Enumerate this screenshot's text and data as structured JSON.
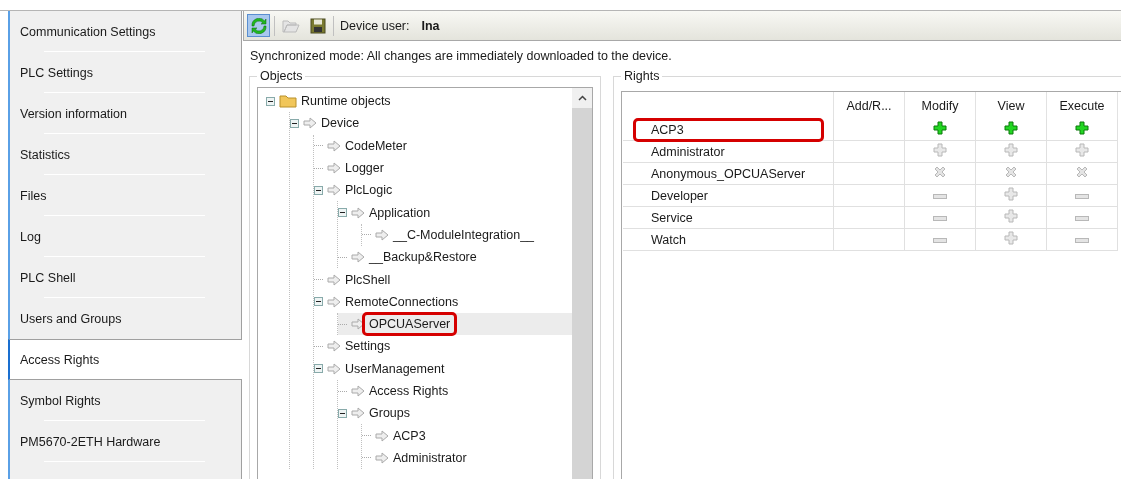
{
  "sidebar": {
    "items": [
      {
        "label": "Communication Settings",
        "selected": false
      },
      {
        "label": "PLC Settings",
        "selected": false
      },
      {
        "label": "Version information",
        "selected": false
      },
      {
        "label": "Statistics",
        "selected": false
      },
      {
        "label": "Files",
        "selected": false
      },
      {
        "label": "Log",
        "selected": false
      },
      {
        "label": "PLC Shell",
        "selected": false
      },
      {
        "label": "Users and Groups",
        "selected": false
      },
      {
        "label": "Access Rights",
        "selected": true
      },
      {
        "label": "Symbol Rights",
        "selected": false
      },
      {
        "label": "PM5670-2ETH Hardware",
        "selected": false
      }
    ]
  },
  "toolbar": {
    "sync_active": true,
    "device_user_label": "Device user:",
    "device_user": "Ina"
  },
  "sync_message": "Synchronized mode: All changes are immediately downloaded to the device.",
  "objects": {
    "title": "Objects",
    "tree": [
      {
        "label": "Runtime objects",
        "kind": "folder",
        "expanded": true,
        "selected": false,
        "highlighted": false,
        "children": [
          {
            "label": "Device",
            "kind": "object",
            "expanded": true,
            "selected": false,
            "highlighted": false,
            "children": [
              {
                "label": "CodeMeter",
                "kind": "object",
                "selected": false,
                "highlighted": false
              },
              {
                "label": "Logger",
                "kind": "object",
                "selected": false,
                "highlighted": false
              },
              {
                "label": "PlcLogic",
                "kind": "object",
                "expanded": true,
                "selected": false,
                "highlighted": false,
                "children": [
                  {
                    "label": "Application",
                    "kind": "object",
                    "expanded": true,
                    "selected": false,
                    "highlighted": false,
                    "children": [
                      {
                        "label": "__C-ModuleIntegration__",
                        "kind": "object",
                        "selected": false,
                        "highlighted": false
                      }
                    ]
                  },
                  {
                    "label": "__Backup&Restore",
                    "kind": "object",
                    "selected": false,
                    "highlighted": false
                  }
                ]
              },
              {
                "label": "PlcShell",
                "kind": "object",
                "selected": false,
                "highlighted": false
              },
              {
                "label": "RemoteConnections",
                "kind": "object",
                "expanded": true,
                "selected": false,
                "highlighted": false,
                "children": [
                  {
                    "label": "OPCUAServer",
                    "kind": "object",
                    "selected": true,
                    "highlighted": true
                  }
                ]
              },
              {
                "label": "Settings",
                "kind": "object",
                "selected": false,
                "highlighted": false
              },
              {
                "label": "UserManagement",
                "kind": "object",
                "expanded": true,
                "selected": false,
                "highlighted": false,
                "children": [
                  {
                    "label": "Access Rights",
                    "kind": "object",
                    "selected": false,
                    "highlighted": false
                  },
                  {
                    "label": "Groups",
                    "kind": "object",
                    "expanded": true,
                    "selected": false,
                    "highlighted": false,
                    "children": [
                      {
                        "label": "ACP3",
                        "kind": "object",
                        "selected": false,
                        "highlighted": false
                      },
                      {
                        "label": "Administrator",
                        "kind": "object",
                        "selected": false,
                        "highlighted": false
                      }
                    ]
                  }
                ]
              }
            ]
          }
        ]
      }
    ]
  },
  "rights": {
    "title": "Rights",
    "columns": [
      "Add/R...",
      "Modify",
      "View",
      "Execute"
    ],
    "rows": [
      {
        "group": "ACP3",
        "highlighted": true,
        "cells": [
          {
            "kind": "granted"
          },
          {
            "kind": "granted"
          },
          {
            "kind": "granted"
          }
        ]
      },
      {
        "group": "Administrator",
        "highlighted": false,
        "cells": [
          {
            "kind": "inherited"
          },
          {
            "kind": "inherited"
          },
          {
            "kind": "inherited"
          }
        ]
      },
      {
        "group": "Anonymous_OPCUAServer",
        "highlighted": false,
        "cells": [
          {
            "kind": "denied"
          },
          {
            "kind": "denied"
          },
          {
            "kind": "denied"
          }
        ]
      },
      {
        "group": "Developer",
        "highlighted": false,
        "cells": [
          {
            "kind": "unset"
          },
          {
            "kind": "inherited"
          },
          {
            "kind": "unset"
          }
        ]
      },
      {
        "group": "Service",
        "highlighted": false,
        "cells": [
          {
            "kind": "unset"
          },
          {
            "kind": "inherited"
          },
          {
            "kind": "unset"
          }
        ]
      },
      {
        "group": "Watch",
        "highlighted": false,
        "cells": [
          {
            "kind": "unset"
          },
          {
            "kind": "inherited"
          },
          {
            "kind": "unset"
          }
        ]
      }
    ]
  }
}
